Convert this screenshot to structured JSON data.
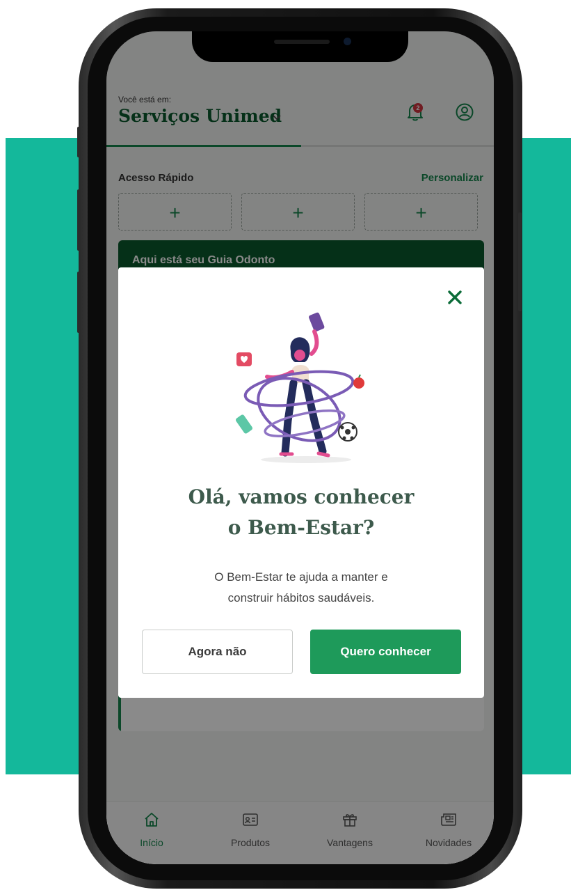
{
  "header": {
    "location_label": "Você está em:",
    "title": "Serviços Unimed",
    "dropdown_icon": "chevron-down-icon",
    "notification_count": "2",
    "notification_icon": "bell-icon",
    "profile_icon": "user-circle-icon"
  },
  "quick_access": {
    "title": "Acesso Rápido",
    "customize_label": "Personalizar",
    "slots": [
      "+",
      "+",
      "+"
    ]
  },
  "guide_card": {
    "title": "Aqui está seu Guia Odonto"
  },
  "modal": {
    "close_icon": "close-icon",
    "title_line1": "Olá, vamos conhecer",
    "title_line2": "o Bem-Estar?",
    "text_line1": "O Bem-Estar te ajuda a manter e",
    "text_line2": "construir hábitos saudáveis.",
    "secondary_button": "Agora não",
    "primary_button": "Quero conhecer"
  },
  "tabbar": {
    "tabs": [
      {
        "label": "Início",
        "icon": "home-icon",
        "active": true
      },
      {
        "label": "Produtos",
        "icon": "id-card-icon",
        "active": false
      },
      {
        "label": "Vantagens",
        "icon": "gift-icon",
        "active": false
      },
      {
        "label": "Novidades",
        "icon": "newspaper-icon",
        "active": false
      }
    ]
  },
  "colors": {
    "brand_green": "#16864c",
    "dark_green": "#0a5a2e",
    "primary_button": "#1e9a5a",
    "teal_background": "#14b89b",
    "badge_red": "#d0343f"
  }
}
